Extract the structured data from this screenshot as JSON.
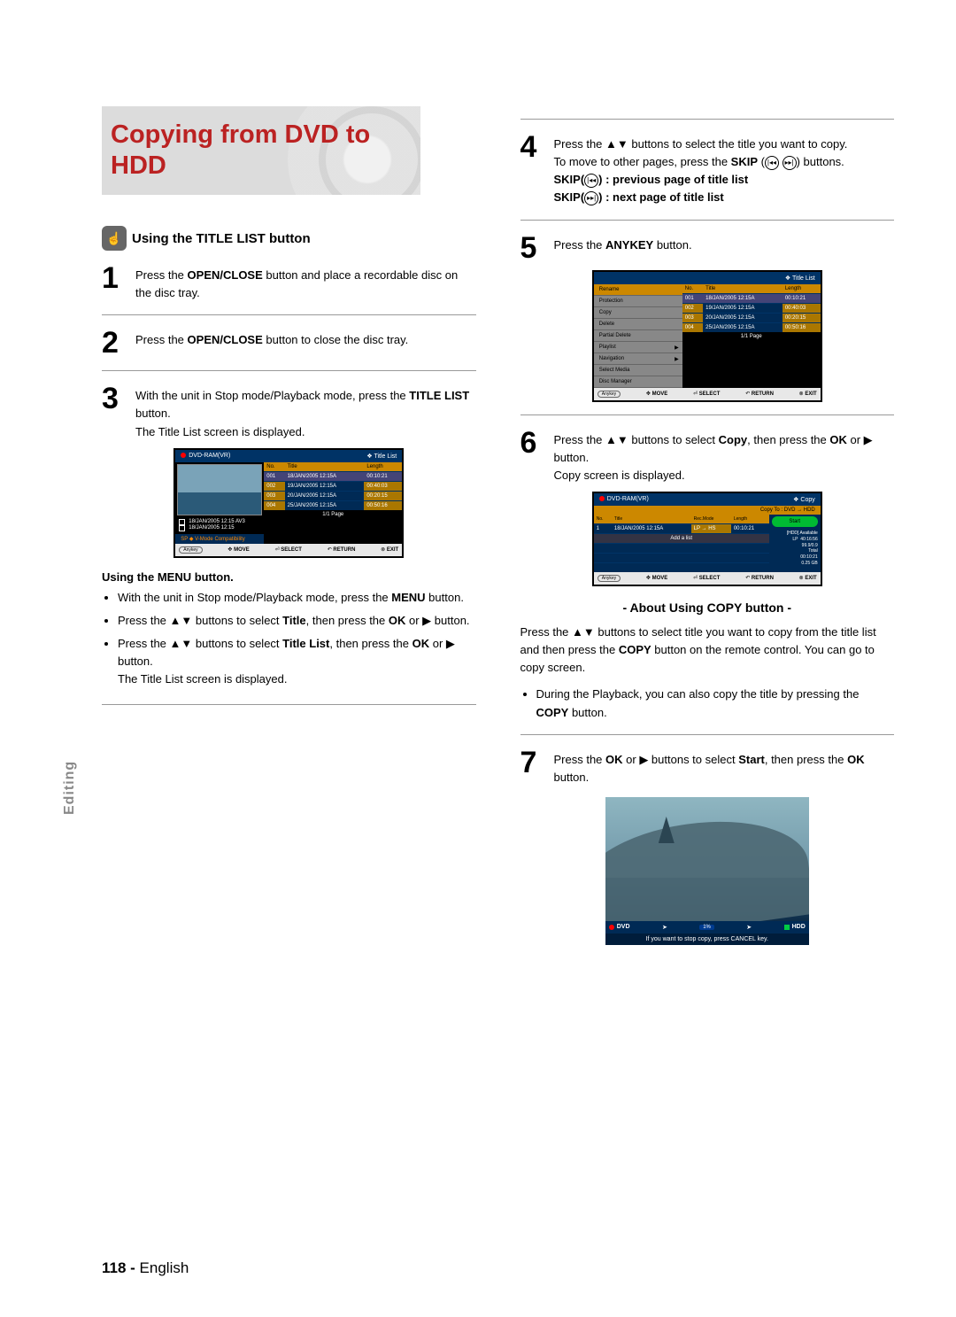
{
  "section_tab": "Editing",
  "hero_title": "Copying from DVD to HDD",
  "section_heading": "Using the TITLE LIST button",
  "steps": {
    "s1_num": "1",
    "s1_a": "Press the ",
    "s1_bold": "OPEN/CLOSE",
    "s1_b": " button and place a recordable disc on the disc tray.",
    "s2_num": "2",
    "s2_a": "Press the ",
    "s2_bold": "OPEN/CLOSE",
    "s2_b": " button to close the disc tray.",
    "s3_num": "3",
    "s3_a": "With the unit in Stop mode/Playback mode, press the ",
    "s3_bold": "TITLE LIST",
    "s3_b": " button.",
    "s3_after": "The Title List screen is displayed.",
    "s4_num": "4",
    "s4_text_a": "Press the ▲▼ buttons to select the title you want to copy.",
    "s4_text_b_1": "To move to other pages, press the ",
    "s4_text_b_bold": "SKIP",
    "s4_text_b_2": " (",
    "s4_text_b_3": ") buttons.",
    "s4_skip_prev_label": "SKIP(",
    "s4_skip_prev_rest": ") : previous page of title list",
    "s4_skip_next_label": "SKIP(",
    "s4_skip_next_rest": ") : next page of title list",
    "s5_num": "5",
    "s5_a": "Press the ",
    "s5_bold": "ANYKEY",
    "s5_b": " button.",
    "s6_num": "6",
    "s6_a": "Press the ▲▼ buttons to select ",
    "s6_bold": "Copy",
    "s6_b": ", then press the ",
    "s6_ok": "OK",
    "s6_c": " or ▶ button.",
    "s6_after": "Copy screen is displayed.",
    "s7_num": "7",
    "s7_a": "Press the ",
    "s7_ok": "OK",
    "s7_b": " or ▶ buttons to select ",
    "s7_start": "Start",
    "s7_c": ", then press the ",
    "s7_ok2": "OK",
    "s7_d": " button."
  },
  "menu_sub_heading": "Using the MENU button.",
  "menu_bullets": {
    "b1_a": "With the unit in Stop mode/Playback mode, press the ",
    "b1_bold": "MENU",
    "b1_b": " button.",
    "b2_a": "Press the ▲▼ buttons to select ",
    "b2_bold": "Title",
    "b2_b": ", then press the ",
    "b2_ok": "OK",
    "b2_c": " or ▶ button.",
    "b3_a": "Press the ▲▼ buttons to select ",
    "b3_bold": "Title List",
    "b3_b": ", then press the ",
    "b3_ok": "OK",
    "b3_c": " or ▶ button.",
    "b3_after": "The Title List screen is displayed."
  },
  "about_heading": "- About Using COPY button -",
  "about_p1_a": "Press the ▲▼ buttons to select title you want to copy from the title list and then press the ",
  "about_p1_bold": "COPY",
  "about_p1_b": " button on the remote control. You can go to copy screen.",
  "about_bullet_a": "During the Playback, you can also copy the title by pressing the ",
  "about_bullet_bold": "COPY",
  "about_bullet_b": " button.",
  "mock_title_list": {
    "hdr": "Title List",
    "disc": "DVD-RAM(VR)",
    "cols": {
      "no": "No.",
      "title": "Title",
      "length": "Length"
    },
    "rows": [
      {
        "no": "001",
        "title": "18/JAN/2005 12:15A",
        "len": "00:10:21"
      },
      {
        "no": "002",
        "title": "19/JAN/2005 12:15A",
        "len": "00:40:03"
      },
      {
        "no": "003",
        "title": "20/JAN/2005 12:15A",
        "len": "00:20:15"
      },
      {
        "no": "004",
        "title": "25/JAN/2005 12:15A",
        "len": "00:50:16"
      }
    ],
    "meta1": "18/JAN/2005 12:15 AV3",
    "meta2": "18/JAN/2005 12:15",
    "rec": "SP ◆ V-Mode Compatibility",
    "page": "1/1 Page",
    "fbar_anykey": "Anykey",
    "fbar_move": "MOVE",
    "fbar_select": "SELECT",
    "fbar_return": "RETURN",
    "fbar_exit": "EXIT"
  },
  "mock_anykey_menu": {
    "items": [
      "Rename",
      "Protection",
      "Copy",
      "Delete",
      "Partial Delete",
      "Playlist",
      "Navigation",
      "Select Media",
      "Disc Manager"
    ]
  },
  "mock_copy": {
    "hdr": "Copy",
    "disc": "DVD-RAM(VR)",
    "copy_to": "Copy To : DVD → HDD",
    "cols": {
      "no": "No.",
      "title": "Title",
      "rec": "Rec.Mode",
      "len": "Length"
    },
    "row": {
      "no": "1",
      "title": "18/JAN/2005 12:15A",
      "rec": "LP → HS",
      "len": "00:10:21"
    },
    "add": "Add a list",
    "start": "Start",
    "avail": {
      "title_label": "[HDD] Available",
      "lp": "LP",
      "lp_time": "40:16:56",
      "ratio": "99.9/0.9",
      "total": "Total",
      "total_time": "00:10:21",
      "gb": "0.25 GB"
    }
  },
  "dolphin_bar": {
    "left": "DVD",
    "pct": "1%",
    "right": "HDD",
    "cancel": "If you want to stop copy, press CANCEL key."
  },
  "page_footer_num": "118 - ",
  "page_footer_lang": "English"
}
